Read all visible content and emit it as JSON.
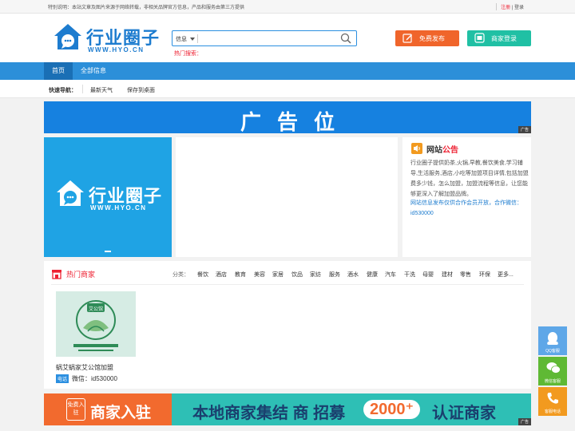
{
  "topbar": {
    "notice": "特别说明：本站文章及图片来源于网络转载，非相关品牌官方信息，产品和服务由第三方提供",
    "register": "注册",
    "sep": "|",
    "login": "登录"
  },
  "header": {
    "brand": "行业圈子",
    "url": "WWW.HYO.CN",
    "search_category": "信息",
    "search_placeholder": "",
    "hot_search": "热门搜索：",
    "publish_button": "免费发布",
    "merchant_login_button": "商家登录"
  },
  "nav": {
    "items": [
      {
        "label": "首页"
      },
      {
        "label": "全部信息"
      }
    ]
  },
  "quick_nav": {
    "title": "快速导航：",
    "links": [
      "最新天气",
      "保存到桌面"
    ]
  },
  "ad_banner": {
    "text": "广告位",
    "tag": "广告"
  },
  "slider": {
    "brand": "行业圈子",
    "url": "WWW.HYO.CN"
  },
  "site_notice": {
    "title_a": "网站",
    "title_b": "公告",
    "body": "行业圈子提供奶茶,火锅,早教,餐饮美食,学习辅导,生活服务,酒店,小吃等加盟项目详情,包括加盟费多少钱，怎么加盟，加盟流程等信息，让您能够更深入了解加盟品牌。",
    "contact": "网站信息发布仅供合作会员开放，合作微信：id530000"
  },
  "hot_merchants": {
    "title": "热门商家",
    "categories_label": "分类：",
    "categories": [
      "餐饮",
      "酒店",
      "教育",
      "美容",
      "家居",
      "饮品",
      "家纺",
      "服务",
      "酒水",
      "健康",
      "汽车",
      "干洗",
      "母婴",
      "建材",
      "零售",
      "环保",
      "更多..."
    ],
    "card": {
      "image_sign": "艾公馆",
      "name": "蜗艾蜗家艾公馆加盟",
      "tag": "电话",
      "wechat": "微信：id530000"
    }
  },
  "bottom_banner": {
    "free": "免费入驻",
    "join": "商家入驻",
    "mid": "本地商家集结 商   招募",
    "number": "2000⁺",
    "end": "认证商家",
    "tag": "广告"
  },
  "side_float": {
    "qq": "QQ客服",
    "wechat": "微信客服",
    "phone": "客服电话"
  },
  "colors": {
    "primary": "#2c8fd9",
    "nav_active": "#1a6fb5",
    "publish": "#f0652b",
    "login": "#20c0a4",
    "accent_red": "#ee2233"
  }
}
